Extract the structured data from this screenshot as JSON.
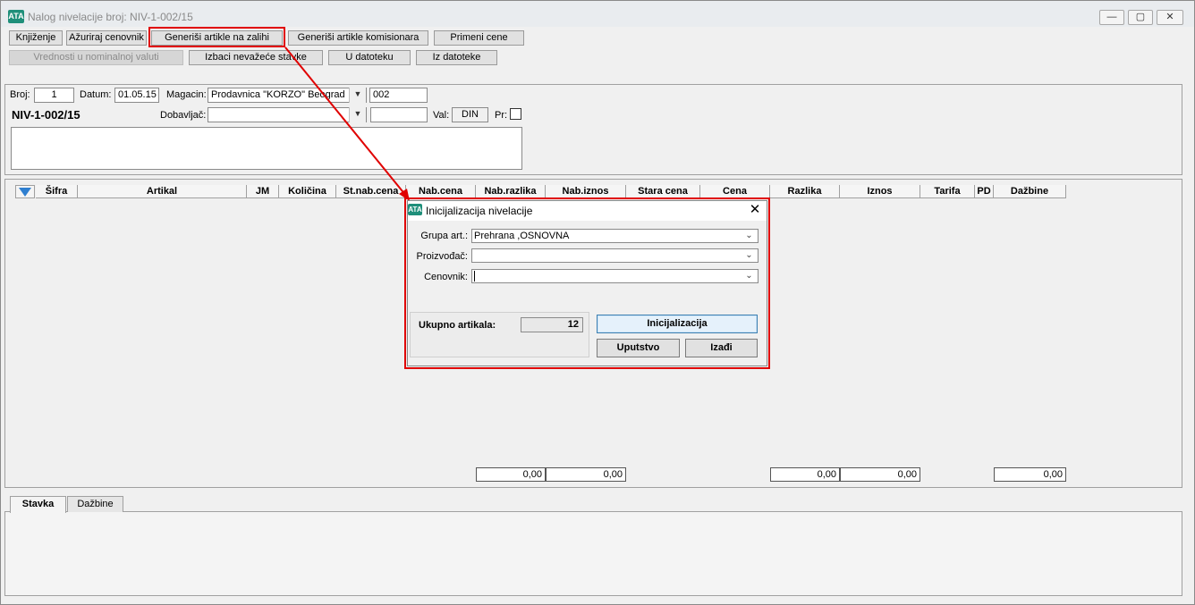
{
  "window": {
    "title": "Nalog nivelacije broj: NIV-1-002/15",
    "icon": "ATA",
    "controls": [
      "—",
      "▢",
      "✕"
    ]
  },
  "toolbar": {
    "row1": [
      "Knjiženje",
      "Ažuriraj cenovnik",
      "Generiši artikle na zalihi",
      "Generiši artikle komisionara",
      "Primeni cene"
    ],
    "row2": [
      "Vrednosti u nominalnoj valuti",
      "Izbaci nevažeće stavke",
      "U datoteku",
      "Iz datoteke"
    ]
  },
  "form": {
    "broj_label": "Broj:",
    "broj_value": "1",
    "datum_label": "Datum:",
    "datum_value": "01.05.15",
    "magacin_label": "Magacin:",
    "magacin_value": "Prodavnica \"KORZO\" Beograd",
    "magacin_code": "002",
    "doc_number": "NIV-1-002/15",
    "dobavljac_label": "Dobavljač:",
    "dobavljac_value": "",
    "val_label": "Val:",
    "val_value": "DIN",
    "pr_label": "Pr:"
  },
  "table": {
    "columns": [
      "Šifra",
      "Artikal",
      "JM",
      "Količina",
      "St.nab.cena",
      "Nab.cena",
      "Nab.razlika",
      "Nab.iznos",
      "Stara cena",
      "Cena",
      "Razlika",
      "Iznos",
      "Tarifa",
      "PD",
      "Dažbine"
    ],
    "totals": [
      "0,00",
      "0,00",
      "0,00",
      "0,00",
      "0,00"
    ]
  },
  "tabs": [
    "Stavka",
    "Dažbine"
  ],
  "dialog": {
    "title": "Inicijalizacija nivelacije",
    "grupa_label": "Grupa art.:",
    "grupa_value": "Prehrana ,OSNOVNA",
    "proizvodjac_label": "Proizvođač:",
    "proizvodjac_value": "",
    "cenovnik_label": "Cenovnik:",
    "cenovnik_value": "",
    "ukupno_label": "Ukupno artikala:",
    "ukupno_value": "12",
    "init_button": "Inicijalizacija",
    "help_button": "Uputstvo",
    "exit_button": "Izađi"
  },
  "colors": {
    "highlight": "#e00000",
    "icon": "#1f8f7a",
    "focus": "#3c7fb1"
  }
}
